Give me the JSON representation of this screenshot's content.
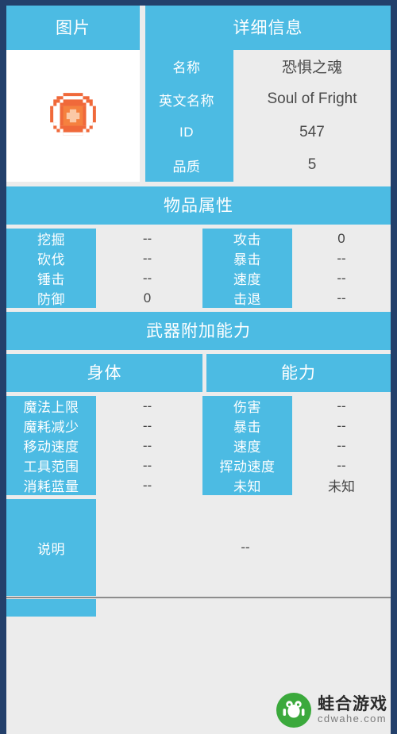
{
  "colors": {
    "frame": "#23406b",
    "accent": "#4cbbe3",
    "panel": "#ececec",
    "text_light": "#ffffff",
    "text_dark": "#444444",
    "watermark_green": "#3ba93c"
  },
  "image_panel": {
    "header": "图片",
    "sprite_name": "soul-of-fright-sprite"
  },
  "detail_panel": {
    "header": "详细信息",
    "rows": [
      {
        "label": "名称",
        "value": "恐惧之魂"
      },
      {
        "label": "英文名称",
        "value": "Soul of Fright"
      },
      {
        "label": "ID",
        "value": "547"
      },
      {
        "label": "品质",
        "value": "5"
      }
    ]
  },
  "item_attributes": {
    "header": "物品属性",
    "left": [
      {
        "label": "挖掘",
        "value": "--"
      },
      {
        "label": "砍伐",
        "value": "--"
      },
      {
        "label": "锤击",
        "value": "--"
      },
      {
        "label": "防御",
        "value": "0"
      }
    ],
    "right": [
      {
        "label": "攻击",
        "value": "0"
      },
      {
        "label": "暴击",
        "value": "--"
      },
      {
        "label": "速度",
        "value": "--"
      },
      {
        "label": "击退",
        "value": "--"
      }
    ]
  },
  "weapon_ability": {
    "header": "武器附加能力",
    "subheader_left": "身体",
    "subheader_right": "能力",
    "left": [
      {
        "label": "魔法上限",
        "value": "--"
      },
      {
        "label": "魔耗减少",
        "value": "--"
      },
      {
        "label": "移动速度",
        "value": "--"
      },
      {
        "label": "工具范围",
        "value": "--"
      },
      {
        "label": "消耗蓝量",
        "value": "--"
      }
    ],
    "right": [
      {
        "label": "伤害",
        "value": "--"
      },
      {
        "label": "暴击",
        "value": "--"
      },
      {
        "label": "速度",
        "value": "--"
      },
      {
        "label": "挥动速度",
        "value": "--"
      },
      {
        "label": "未知",
        "value": "未知"
      }
    ]
  },
  "description": {
    "label": "说明",
    "value": "--"
  },
  "watermark": {
    "title": "蛙合游戏",
    "subtitle": "cdwahe.com"
  }
}
